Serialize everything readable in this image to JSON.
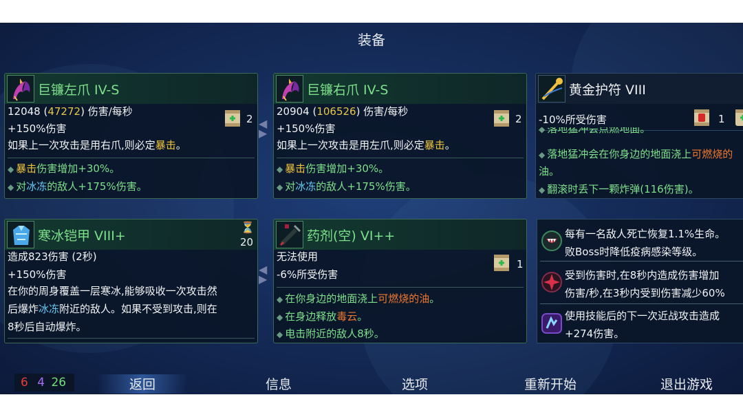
{
  "header": {
    "title": "装备"
  },
  "weapons": [
    {
      "name": "巨镰左爪 IV-S",
      "dps": "12048",
      "dps_alt": "47272",
      "dps_unit": "伤害/每秒",
      "bonus": "+150%伤害",
      "scroll_count": "2",
      "desc_pre": "如果上一次攻击是用右爪,则必定",
      "desc_kw": "暴击",
      "desc_post": "。",
      "mods": [
        {
          "kw": "暴击",
          "text": "伤害增加+30%。"
        },
        {
          "pre": "对",
          "kw": "冰冻",
          "text": "的敌人+175%伤害。"
        }
      ]
    },
    {
      "name": "巨镰右爪 IV-S",
      "dps": "20904",
      "dps_alt": "106526",
      "dps_unit": "伤害/每秒",
      "bonus": "+150%伤害",
      "scroll_count": "2",
      "desc_pre": "如果上一次攻击是用左爪,则必定",
      "desc_kw": "暴击",
      "desc_post": "。",
      "mods": [
        {
          "kw": "暴击",
          "text": "伤害增加+30%。"
        },
        {
          "pre": "对",
          "kw": "冰冻",
          "text": "的敌人+175%伤害。"
        }
      ]
    }
  ],
  "amulet": {
    "name": "黄金护符 VIII",
    "stat": "-10%所受伤害",
    "fist_count": "1",
    "mod_cut": "落地猛冲会点燃地面。",
    "mod1_pre": "落地猛冲会在你身边的地面浇上",
    "mod1_kw": "可燃烧的",
    "mod1_tail": "油。",
    "mod2": "翻滚时丢下一颗炸弹(116伤害)。"
  },
  "armor": {
    "name": "寒冰铠甲 VIII+",
    "cooldown": "20",
    "effect": "造成823伤害 (2秒)",
    "bonus": "+150%伤害",
    "desc_line1": "在你的周身覆盖一层寒冰,能够吸收一次攻击然",
    "desc_line2_pre": "后爆炸",
    "desc_line2_kw": "冰冻",
    "desc_line2_post": "附近的敌人。如果不受到攻击,则在",
    "desc_line3": "8秒后自动爆炸。"
  },
  "potion": {
    "name": "药剂(空) VI++",
    "status": "无法使用",
    "stat": "-6%所受伤害",
    "scroll_count": "1",
    "mod1_pre": "在你身边的地面浇上",
    "mod1_kw": "可燃烧的油",
    "mod1_post": "。",
    "mod2_pre": "在身边释放",
    "mod2_kw": "毒云",
    "mod2_post": "。",
    "mod3": "电击附近的敌人8秒。"
  },
  "passives": [
    {
      "line1": "每有一名敌人死亡恢复1.1%生命。",
      "line2": "败Boss时降低疫病感染等级。"
    },
    {
      "line1": "受到伤害时,在8秒内造成伤害增加",
      "line2": "伤害/秒,在3秒内受到伤害减少60%"
    },
    {
      "line1": "使用技能后的下一次近战攻击造成",
      "line2": "+274伤害。"
    }
  ],
  "stats": {
    "red": "6",
    "purple": "4",
    "green": "26",
    "colors": {
      "red": "#ef3b3b",
      "purple": "#a86cf0",
      "green": "#6fe07a"
    }
  },
  "menu": {
    "back": "返回",
    "info": "信息",
    "options": "选项",
    "restart": "重新开始",
    "quit": "退出游戏"
  },
  "icons": {
    "claw": "scythe-claw-icon",
    "amulet": "gold-amulet-icon",
    "armor": "ice-armor-icon",
    "potion": "potion-syringe-icon",
    "scroll": "power-scroll-icon",
    "fist": "red-fist-scroll-icon",
    "hourglass": "cooldown-hourglass-icon"
  }
}
